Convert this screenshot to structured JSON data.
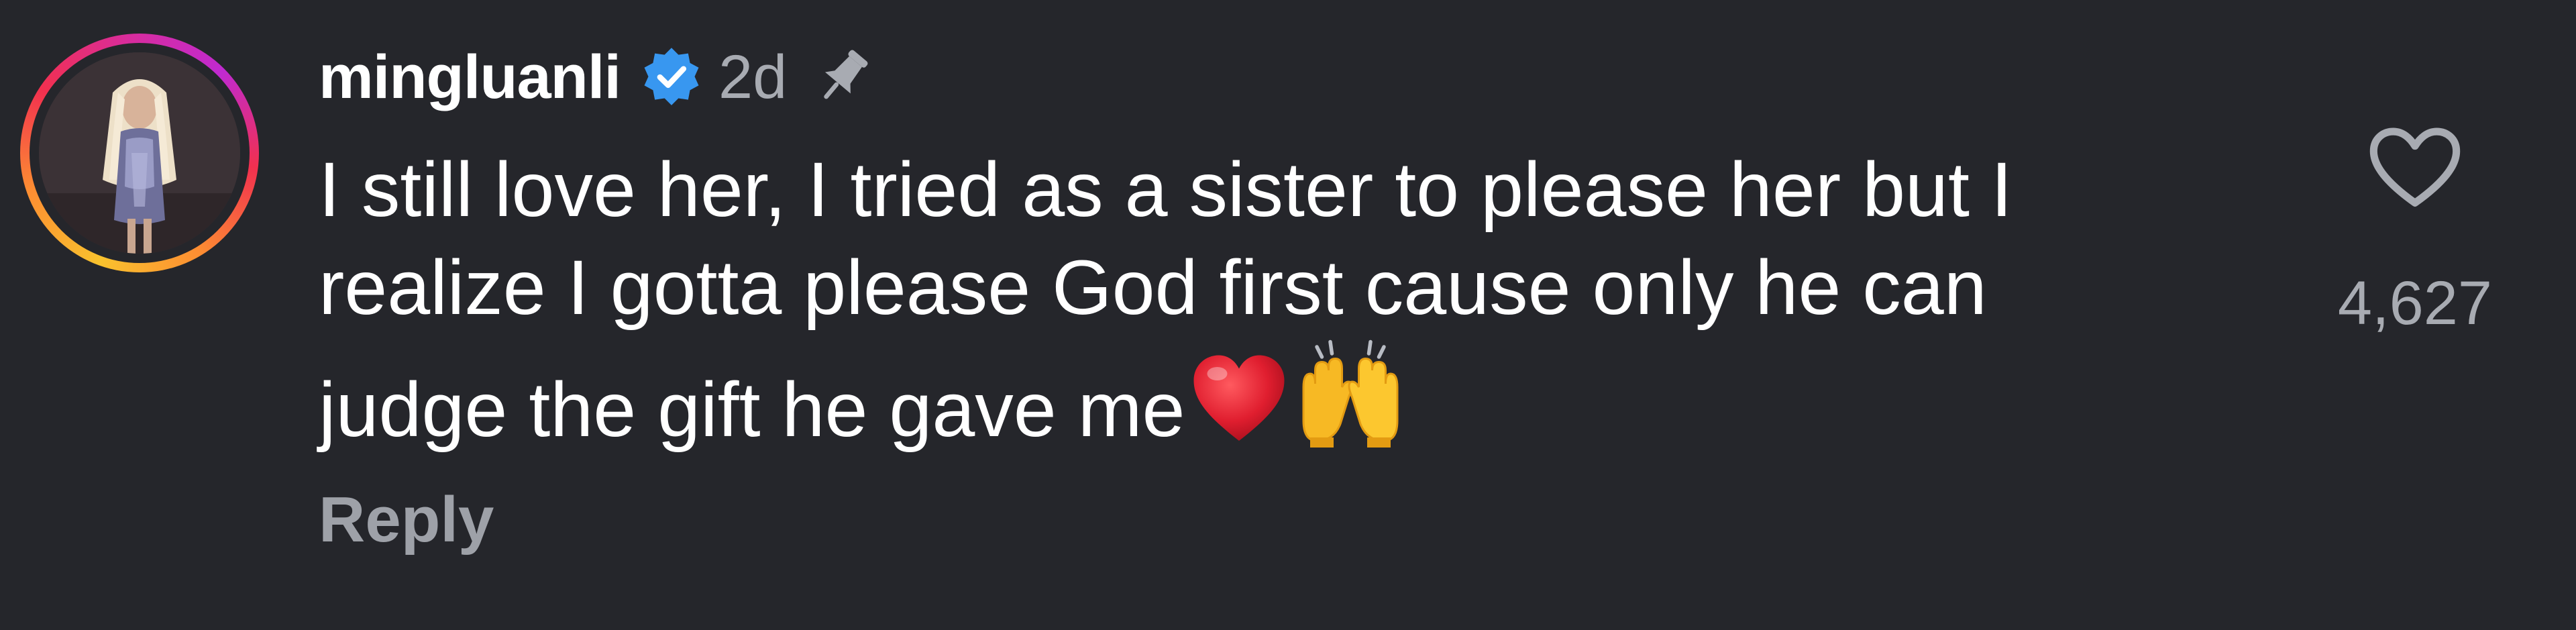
{
  "comment": {
    "username": "mingluanli",
    "verified": true,
    "time_ago": "2d",
    "pinned": true,
    "text_lines": [
      "I still love her, I tried as a sister to please her but I",
      "realize I gotta please God first cause only he can",
      "judge the gift he gave me"
    ],
    "trailing_emojis": [
      "red-heart",
      "raising-hands"
    ],
    "reply_label": "Reply",
    "like_count": "4,627"
  },
  "colors": {
    "background": "#25262b",
    "text": "#ffffff",
    "muted_text": "#a8abb2",
    "verified_badge": "#3897f0",
    "heart_emoji": "#e01e2f"
  },
  "icons": {
    "verified": "verified-badge-icon",
    "pin": "pin-icon",
    "like": "heart-outline-icon"
  }
}
